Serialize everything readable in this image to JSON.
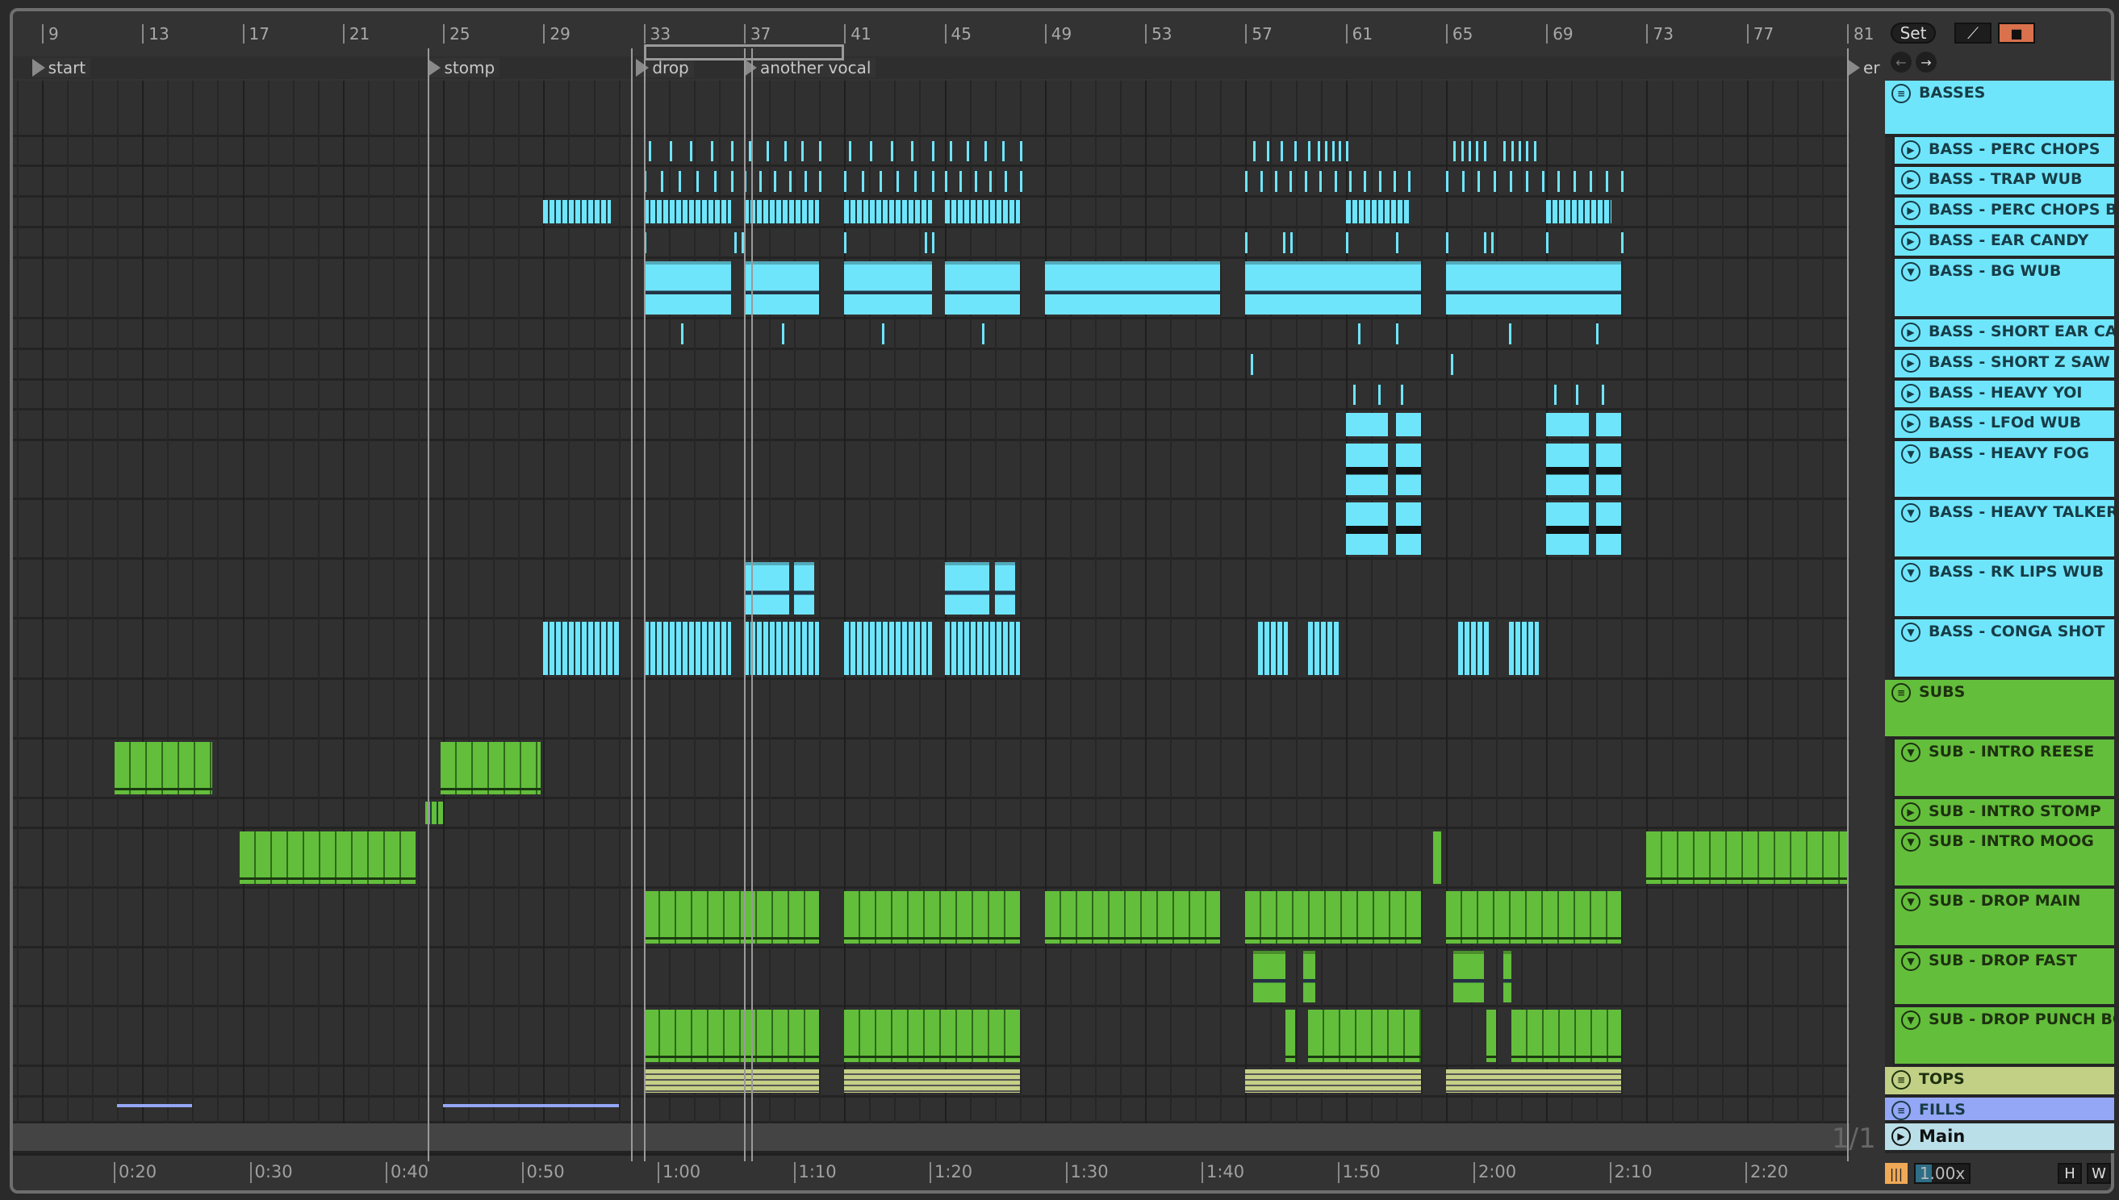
{
  "ruler": {
    "bars": [
      "9",
      "13",
      "17",
      "21",
      "25",
      "29",
      "33",
      "37",
      "41",
      "45",
      "49",
      "53",
      "57",
      "61",
      "65",
      "69",
      "73",
      "77",
      "81"
    ]
  },
  "locators": {
    "start": "start",
    "stomp": "stomp",
    "drop": "drop",
    "another_vocal": "another vocal",
    "end": "er"
  },
  "time_ruler": [
    "0:20",
    "0:30",
    "0:40",
    "0:50",
    "1:00",
    "1:10",
    "1:20",
    "1:30",
    "1:40",
    "1:50",
    "2:00",
    "2:10",
    "2:20"
  ],
  "controls": {
    "set_label": "Set",
    "draw_icon": "pencil-icon",
    "lock_icon": "lock-icon",
    "zoom_value": "1.00x",
    "h_label": "H",
    "w_label": "W",
    "page_indicator": "1/1"
  },
  "colors": {
    "basses": "#6fe5fb",
    "subs": "#63be3b",
    "tops": "#c2d085",
    "fills": "#94a6f6",
    "main": "#badfe8",
    "lock": "#d9714d"
  },
  "tracks": [
    {
      "name": "BASSES",
      "type": "group",
      "color": "basses"
    },
    {
      "name": "BASS - PERC CHOPS",
      "type": "collapsed",
      "color": "basses"
    },
    {
      "name": "BASS - TRAP WUB",
      "type": "collapsed",
      "color": "basses"
    },
    {
      "name": "BASS - PERC CHOPS BG",
      "type": "collapsed",
      "color": "basses"
    },
    {
      "name": "BASS - EAR CANDY",
      "type": "collapsed",
      "color": "basses"
    },
    {
      "name": "BASS - BG WUB",
      "type": "expanded",
      "color": "basses"
    },
    {
      "name": "BASS - SHORT EAR CAN",
      "type": "collapsed",
      "color": "basses"
    },
    {
      "name": "BASS - SHORT Z SAW TA",
      "type": "collapsed",
      "color": "basses"
    },
    {
      "name": "BASS - HEAVY YOI",
      "type": "collapsed",
      "color": "basses"
    },
    {
      "name": "BASS - LFOd WUB",
      "type": "collapsed",
      "color": "basses"
    },
    {
      "name": "BASS - HEAVY FOG",
      "type": "expanded",
      "color": "basses"
    },
    {
      "name": "BASS - HEAVY TALKER",
      "type": "expanded",
      "color": "basses"
    },
    {
      "name": "BASS - RK LIPS WUB",
      "type": "expanded",
      "color": "basses"
    },
    {
      "name": "BASS - CONGA SHOT",
      "type": "expanded",
      "color": "basses"
    },
    {
      "name": "SUBS",
      "type": "group",
      "color": "subs"
    },
    {
      "name": "SUB - INTRO REESE",
      "type": "expanded",
      "color": "subs"
    },
    {
      "name": "SUB - INTRO STOMP",
      "type": "collapsed",
      "color": "subs"
    },
    {
      "name": "SUB - INTRO MOOG",
      "type": "expanded",
      "color": "subs"
    },
    {
      "name": "SUB - DROP MAIN",
      "type": "expanded",
      "color": "subs"
    },
    {
      "name": "SUB - DROP FAST",
      "type": "expanded",
      "color": "subs"
    },
    {
      "name": "SUB - DROP PUNCH BO",
      "type": "expanded",
      "color": "subs"
    },
    {
      "name": "TOPS",
      "type": "group",
      "color": "tops"
    },
    {
      "name": "FILLS",
      "type": "group",
      "color": "fills"
    },
    {
      "name": "Main",
      "type": "main",
      "color": "main"
    }
  ]
}
